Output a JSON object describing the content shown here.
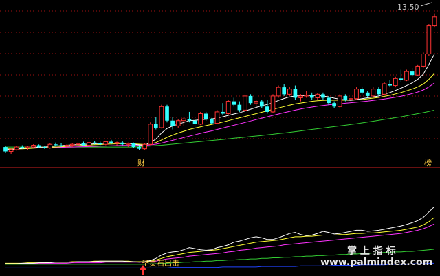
{
  "chart_data": {
    "type": "candlestick",
    "price_label": "13.50",
    "bottom_tags": {
      "left": "财",
      "right": "榜"
    },
    "signal_text": "圣灵石出击",
    "watermark": {
      "line1": "掌 上 指 标",
      "line2": "www.palmindex.com"
    },
    "colors": {
      "up": "#ff3333",
      "down": "#33ffff",
      "ma_white": "#ffffff",
      "ma_yellow": "#ffff33",
      "ma_magenta": "#ff33ff",
      "ma_green": "#33cc33",
      "blue_line": "#2244ff",
      "separator": "#d02020",
      "grid": "#a01010"
    },
    "x": [
      0,
      1,
      2,
      3,
      4,
      5,
      6,
      7,
      8,
      9,
      10,
      11,
      12,
      13,
      14,
      15,
      16,
      17,
      18,
      19,
      20,
      21,
      22,
      23,
      24,
      25,
      26,
      27,
      28,
      29,
      30,
      31,
      32,
      33,
      34,
      35,
      36,
      37,
      38,
      39,
      40,
      41,
      42,
      43,
      44,
      45,
      46,
      47,
      48,
      49,
      50,
      51,
      52,
      53,
      54,
      55,
      56,
      57,
      58,
      59,
      60,
      61,
      62,
      63,
      64,
      65,
      66,
      67,
      68,
      69,
      70,
      71,
      72,
      73,
      74,
      75,
      76,
      77
    ],
    "ohlc": [
      [
        5.9,
        5.95,
        5.55,
        5.65
      ],
      [
        5.65,
        5.8,
        5.5,
        5.75
      ],
      [
        5.75,
        5.95,
        5.7,
        5.9
      ],
      [
        5.9,
        6.0,
        5.8,
        5.85
      ],
      [
        5.85,
        5.95,
        5.75,
        5.9
      ],
      [
        5.9,
        6.05,
        5.85,
        6.0
      ],
      [
        6.0,
        6.05,
        5.85,
        5.9
      ],
      [
        5.9,
        5.95,
        5.8,
        5.85
      ],
      [
        5.85,
        6.1,
        5.8,
        6.05
      ],
      [
        6.05,
        6.15,
        5.95,
        6.0
      ],
      [
        6.0,
        6.1,
        5.9,
        5.95
      ],
      [
        5.95,
        6.05,
        5.85,
        6.0
      ],
      [
        6.0,
        6.1,
        5.9,
        6.05
      ],
      [
        6.05,
        6.15,
        5.95,
        6.1
      ],
      [
        6.1,
        6.2,
        5.95,
        6.0
      ],
      [
        6.0,
        6.2,
        5.95,
        6.15
      ],
      [
        6.15,
        6.25,
        6.05,
        6.1
      ],
      [
        6.1,
        6.2,
        6.0,
        6.05
      ],
      [
        6.05,
        6.25,
        6.0,
        6.2
      ],
      [
        6.2,
        6.3,
        6.05,
        6.1
      ],
      [
        6.1,
        6.2,
        6.0,
        6.15
      ],
      [
        6.15,
        6.25,
        6.0,
        6.05
      ],
      [
        6.05,
        6.15,
        5.9,
        6.1
      ],
      [
        6.1,
        6.15,
        5.85,
        5.9
      ],
      [
        5.9,
        6.0,
        5.75,
        5.8
      ],
      [
        5.8,
        6.1,
        5.75,
        6.05
      ],
      [
        6.05,
        7.3,
        6.0,
        7.2
      ],
      [
        7.2,
        7.6,
        6.9,
        7.0
      ],
      [
        7.0,
        8.3,
        6.95,
        8.2
      ],
      [
        8.2,
        8.3,
        7.3,
        7.4
      ],
      [
        7.4,
        7.6,
        6.9,
        7.1
      ],
      [
        7.1,
        7.5,
        7.0,
        7.4
      ],
      [
        7.4,
        7.6,
        7.1,
        7.5
      ],
      [
        7.5,
        7.9,
        7.3,
        7.4
      ],
      [
        7.4,
        7.5,
        7.1,
        7.2
      ],
      [
        7.2,
        7.9,
        7.15,
        7.8
      ],
      [
        7.8,
        7.9,
        7.4,
        7.5
      ],
      [
        7.5,
        7.55,
        7.2,
        7.25
      ],
      [
        7.25,
        8.0,
        7.2,
        7.9
      ],
      [
        7.9,
        8.4,
        7.7,
        7.8
      ],
      [
        7.8,
        8.6,
        7.75,
        8.5
      ],
      [
        8.5,
        8.7,
        8.2,
        8.3
      ],
      [
        8.3,
        8.5,
        7.9,
        8.0
      ],
      [
        8.0,
        8.9,
        7.95,
        8.8
      ],
      [
        8.8,
        8.9,
        8.3,
        8.4
      ],
      [
        8.4,
        8.6,
        8.2,
        8.5
      ],
      [
        8.5,
        8.6,
        8.1,
        8.2
      ],
      [
        8.2,
        8.6,
        7.8,
        7.9
      ],
      [
        7.9,
        8.9,
        7.85,
        8.8
      ],
      [
        8.8,
        9.4,
        8.7,
        9.3
      ],
      [
        9.3,
        9.5,
        8.8,
        8.9
      ],
      [
        8.9,
        9.3,
        8.8,
        9.2
      ],
      [
        9.2,
        9.4,
        8.6,
        8.7
      ],
      [
        8.7,
        8.9,
        8.5,
        8.8
      ],
      [
        8.8,
        9.1,
        8.7,
        8.85
      ],
      [
        8.85,
        9.0,
        8.6,
        8.7
      ],
      [
        8.7,
        8.95,
        8.6,
        8.9
      ],
      [
        8.9,
        9.0,
        8.6,
        8.7
      ],
      [
        8.7,
        8.8,
        8.3,
        8.4
      ],
      [
        8.4,
        8.5,
        8.1,
        8.2
      ],
      [
        8.2,
        8.9,
        8.15,
        8.8
      ],
      [
        8.8,
        8.9,
        8.5,
        8.6
      ],
      [
        8.6,
        8.7,
        8.45,
        8.65
      ],
      [
        8.65,
        9.3,
        8.6,
        9.2
      ],
      [
        9.2,
        9.3,
        8.9,
        9.0
      ],
      [
        9.0,
        9.1,
        8.7,
        8.8
      ],
      [
        8.8,
        9.3,
        8.75,
        9.2
      ],
      [
        9.2,
        9.3,
        8.8,
        8.9
      ],
      [
        8.9,
        9.6,
        8.85,
        9.5
      ],
      [
        9.5,
        9.7,
        9.3,
        9.4
      ],
      [
        9.4,
        9.9,
        9.3,
        9.8
      ],
      [
        9.8,
        10.3,
        9.6,
        9.7
      ],
      [
        9.7,
        10.3,
        9.65,
        10.2
      ],
      [
        10.2,
        10.4,
        9.9,
        10.0
      ],
      [
        10.0,
        10.6,
        9.95,
        10.5
      ],
      [
        10.5,
        11.3,
        10.4,
        11.2
      ],
      [
        11.2,
        12.9,
        11.1,
        12.8
      ],
      [
        12.8,
        13.5,
        12.7,
        13.3
      ]
    ],
    "ma_white": [
      5.78,
      5.76,
      5.78,
      5.82,
      5.84,
      5.86,
      5.89,
      5.9,
      5.93,
      5.96,
      5.98,
      6.0,
      6.02,
      6.04,
      6.05,
      6.06,
      6.08,
      6.1,
      6.11,
      6.12,
      6.12,
      6.12,
      6.1,
      6.06,
      6.02,
      6.0,
      6.15,
      6.35,
      6.7,
      6.95,
      7.1,
      7.2,
      7.3,
      7.4,
      7.42,
      7.45,
      7.48,
      7.5,
      7.55,
      7.62,
      7.7,
      7.78,
      7.85,
      7.95,
      8.05,
      8.15,
      8.25,
      8.32,
      8.42,
      8.55,
      8.66,
      8.75,
      8.8,
      8.82,
      8.82,
      8.83,
      8.82,
      8.8,
      8.75,
      8.68,
      8.62,
      8.58,
      8.55,
      8.6,
      8.65,
      8.7,
      8.75,
      8.8,
      8.9,
      9.0,
      9.12,
      9.25,
      9.4,
      9.55,
      9.75,
      10.05,
      10.6,
      11.2
    ],
    "ma_yellow": [
      5.8,
      5.79,
      5.79,
      5.8,
      5.81,
      5.83,
      5.85,
      5.86,
      5.88,
      5.9,
      5.92,
      5.94,
      5.96,
      5.98,
      6.0,
      6.01,
      6.03,
      6.04,
      6.06,
      6.07,
      6.08,
      6.09,
      6.09,
      6.08,
      6.06,
      6.04,
      6.08,
      6.15,
      6.3,
      6.45,
      6.58,
      6.7,
      6.8,
      6.9,
      6.98,
      7.05,
      7.12,
      7.18,
      7.25,
      7.32,
      7.4,
      7.48,
      7.56,
      7.64,
      7.72,
      7.8,
      7.88,
      7.96,
      8.04,
      8.12,
      8.2,
      8.28,
      8.35,
      8.4,
      8.45,
      8.5,
      8.53,
      8.55,
      8.56,
      8.56,
      8.56,
      8.56,
      8.56,
      8.58,
      8.6,
      8.64,
      8.68,
      8.72,
      8.78,
      8.84,
      8.92,
      9.0,
      9.1,
      9.2,
      9.32,
      9.48,
      9.75,
      10.1
    ],
    "ma_magenta": [
      5.85,
      5.84,
      5.84,
      5.84,
      5.84,
      5.85,
      5.85,
      5.86,
      5.86,
      5.87,
      5.88,
      5.89,
      5.9,
      5.91,
      5.92,
      5.93,
      5.94,
      5.95,
      5.96,
      5.97,
      5.98,
      5.99,
      5.99,
      5.99,
      5.99,
      5.99,
      6.02,
      6.06,
      6.12,
      6.2,
      6.28,
      6.36,
      6.44,
      6.52,
      6.6,
      6.68,
      6.75,
      6.82,
      6.9,
      6.98,
      7.06,
      7.14,
      7.22,
      7.3,
      7.38,
      7.46,
      7.54,
      7.62,
      7.7,
      7.78,
      7.86,
      7.93,
      8.0,
      8.06,
      8.12,
      8.17,
      8.22,
      8.26,
      8.3,
      8.33,
      8.36,
      8.39,
      8.42,
      8.45,
      8.48,
      8.51,
      8.55,
      8.59,
      8.63,
      8.68,
      8.73,
      8.79,
      8.86,
      8.94,
      9.03,
      9.15,
      9.32,
      9.55
    ],
    "ma_green": [
      5.9,
      5.9,
      5.9,
      5.9,
      5.9,
      5.9,
      5.9,
      5.9,
      5.9,
      5.9,
      5.9,
      5.9,
      5.9,
      5.9,
      5.9,
      5.9,
      5.9,
      5.9,
      5.9,
      5.9,
      5.9,
      5.9,
      5.9,
      5.9,
      5.92,
      5.94,
      5.96,
      5.98,
      6.0,
      6.03,
      6.06,
      6.09,
      6.12,
      6.15,
      6.18,
      6.21,
      6.24,
      6.27,
      6.3,
      6.33,
      6.36,
      6.4,
      6.43,
      6.46,
      6.5,
      6.53,
      6.56,
      6.6,
      6.63,
      6.67,
      6.7,
      6.74,
      6.78,
      6.82,
      6.86,
      6.9,
      6.94,
      6.98,
      7.02,
      7.06,
      7.1,
      7.14,
      7.18,
      7.22,
      7.27,
      7.32,
      7.37,
      7.42,
      7.47,
      7.52,
      7.57,
      7.62,
      7.68,
      7.74,
      7.8,
      7.86,
      7.93,
      8.0
    ],
    "ind_white": [
      10,
      10,
      10,
      11,
      11,
      11,
      12,
      12,
      12,
      13,
      13,
      13,
      13,
      14,
      14,
      14,
      14,
      15,
      15,
      15,
      15,
      15,
      14,
      14,
      13,
      14,
      16,
      20,
      26,
      30,
      32,
      33,
      36,
      40,
      38,
      36,
      35,
      36,
      40,
      42,
      45,
      50,
      52,
      55,
      58,
      60,
      58,
      55,
      55,
      58,
      62,
      66,
      68,
      64,
      62,
      63,
      66,
      70,
      68,
      65,
      66,
      68,
      70,
      72,
      72,
      70,
      71,
      72,
      74,
      76,
      78,
      80,
      83,
      86,
      90,
      96,
      106,
      116
    ],
    "ind_yellow": [
      11,
      11,
      11,
      11,
      12,
      12,
      12,
      12,
      13,
      13,
      13,
      13,
      14,
      14,
      14,
      14,
      15,
      15,
      15,
      15,
      15,
      15,
      15,
      14,
      14,
      14,
      15,
      17,
      20,
      23,
      25,
      27,
      29,
      31,
      32,
      33,
      34,
      35,
      36,
      38,
      40,
      42,
      44,
      46,
      48,
      50,
      51,
      52,
      53,
      54,
      56,
      58,
      60,
      60,
      61,
      61,
      62,
      63,
      63,
      63,
      64,
      64,
      65,
      66,
      66,
      67,
      67,
      68,
      69,
      70,
      71,
      72,
      74,
      76,
      78,
      82,
      88,
      96
    ],
    "ind_magenta": [
      10,
      10,
      10,
      10,
      10,
      10,
      11,
      11,
      11,
      11,
      11,
      11,
      12,
      12,
      12,
      12,
      12,
      12,
      13,
      13,
      13,
      13,
      13,
      13,
      13,
      13,
      14,
      15,
      17,
      19,
      20,
      21,
      22,
      24,
      25,
      26,
      27,
      28,
      29,
      30,
      32,
      33,
      35,
      36,
      37,
      39,
      40,
      41,
      42,
      43,
      45,
      46,
      47,
      48,
      49,
      50,
      51,
      52,
      53,
      54,
      55,
      56,
      57,
      58,
      59,
      60,
      61,
      62,
      63,
      64,
      65,
      66,
      68,
      70,
      72,
      75,
      79,
      84
    ],
    "ind_green": [
      9,
      9,
      9,
      9,
      9,
      9,
      9,
      9,
      9,
      9,
      9,
      9,
      9,
      9,
      9,
      9,
      9,
      9,
      9,
      9,
      9,
      9,
      9,
      9,
      9,
      9,
      10,
      10,
      11,
      11,
      12,
      12,
      13,
      13,
      14,
      14,
      15,
      15,
      16,
      16,
      17,
      17,
      18,
      18,
      19,
      19,
      20,
      20,
      21,
      21,
      22,
      22,
      23,
      23,
      24,
      24,
      25,
      25,
      26,
      26,
      27,
      27,
      28,
      28,
      29,
      29,
      30,
      30,
      31,
      31,
      32,
      32,
      33,
      33,
      34,
      35,
      36,
      37
    ],
    "ind_blue": [
      2,
      2,
      2,
      2,
      2,
      2,
      2,
      2,
      2,
      2,
      2,
      2,
      2,
      2,
      2,
      2,
      2,
      2,
      2,
      2,
      2,
      2,
      2,
      2,
      2,
      2,
      2,
      2,
      2,
      2,
      3,
      3,
      3,
      3,
      3,
      3,
      3,
      3,
      3,
      4,
      4,
      4,
      4,
      4,
      4,
      4,
      5,
      5,
      5,
      5,
      5,
      5,
      5,
      6,
      6,
      6,
      6,
      6,
      6,
      7,
      7,
      7,
      7,
      7,
      8,
      8,
      8,
      8,
      8,
      9,
      9,
      9,
      9,
      10,
      10,
      10,
      11,
      11
    ],
    "signal_index": 25,
    "price_range": [
      5.2,
      13.8
    ],
    "ind_range": [
      0,
      140
    ]
  }
}
